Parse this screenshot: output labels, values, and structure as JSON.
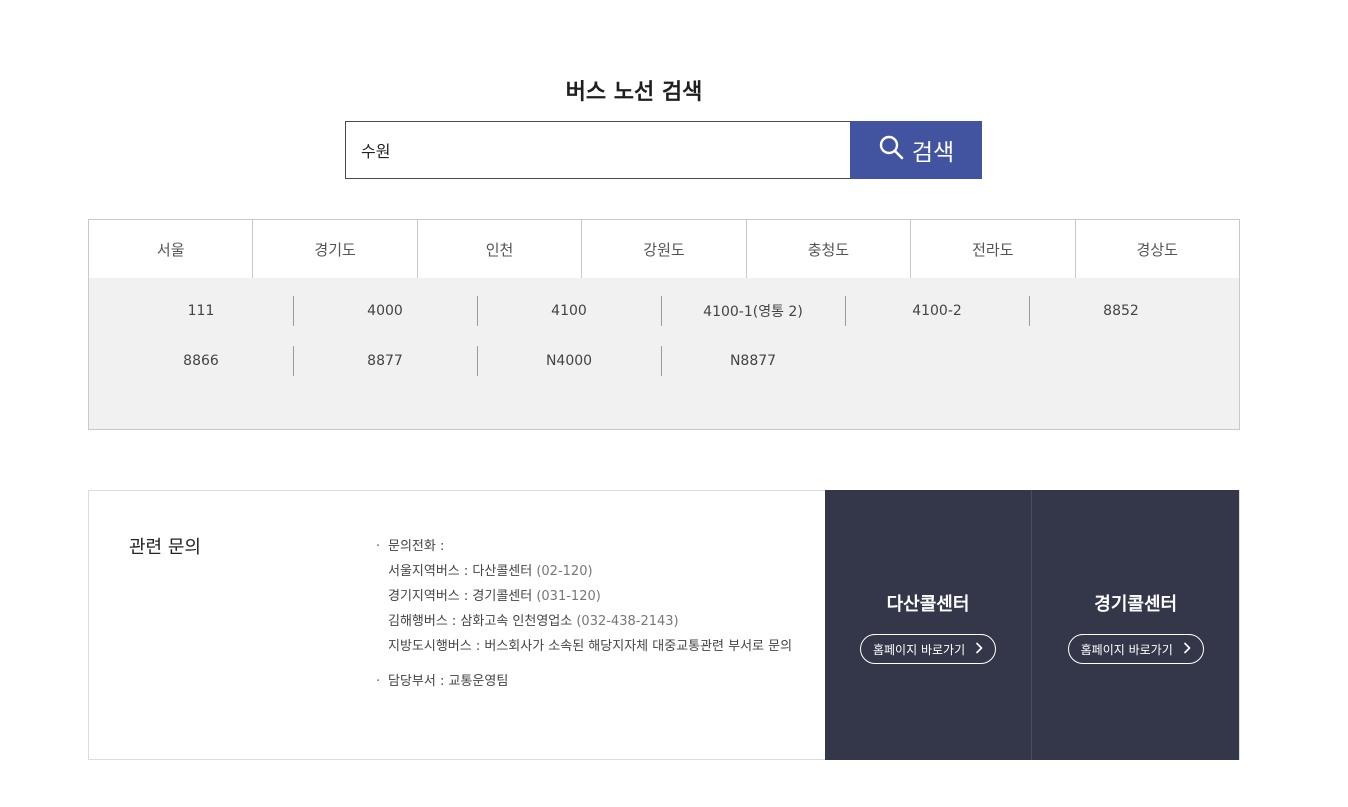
{
  "page_title": "버스 노선 검색",
  "search": {
    "value": "수원",
    "button_label": "검색"
  },
  "region_tabs": [
    "서울",
    "경기도",
    "인천",
    "강원도",
    "충청도",
    "전라도",
    "경상도"
  ],
  "routes": [
    "111",
    "4000",
    "4100",
    "4100-1(영통 2)",
    "4100-2",
    "8852",
    "8866",
    "8877",
    "N4000",
    "N8877"
  ],
  "inquiry": {
    "title": "관련 문의",
    "phone_label": "문의전화 :",
    "lines": [
      {
        "text": "서울지역버스 : 다산콜센터 ",
        "num": "(02-120)"
      },
      {
        "text": "경기지역버스 : 경기콜센터 ",
        "num": "(031-120)"
      },
      {
        "text": "김해행버스 : 삼화고속 인천영업소 ",
        "num": "(032-438-2143)"
      },
      {
        "text": "지방도시행버스 : 버스회사가 소속된 해당지자체 대중교통관련 부서로 문의",
        "num": ""
      }
    ],
    "dept": "담당부서 : 교통운영팀"
  },
  "call_centers": [
    {
      "name": "다산콜센터",
      "button": "홈페이지 바로가기"
    },
    {
      "name": "경기콜센터",
      "button": "홈페이지 바로가기"
    }
  ],
  "colors": {
    "accent": "#4253a0",
    "dark_panel": "#343749",
    "panel_bg": "#f1f1f1"
  },
  "icons": [
    "search-icon",
    "chevron-right-icon"
  ]
}
